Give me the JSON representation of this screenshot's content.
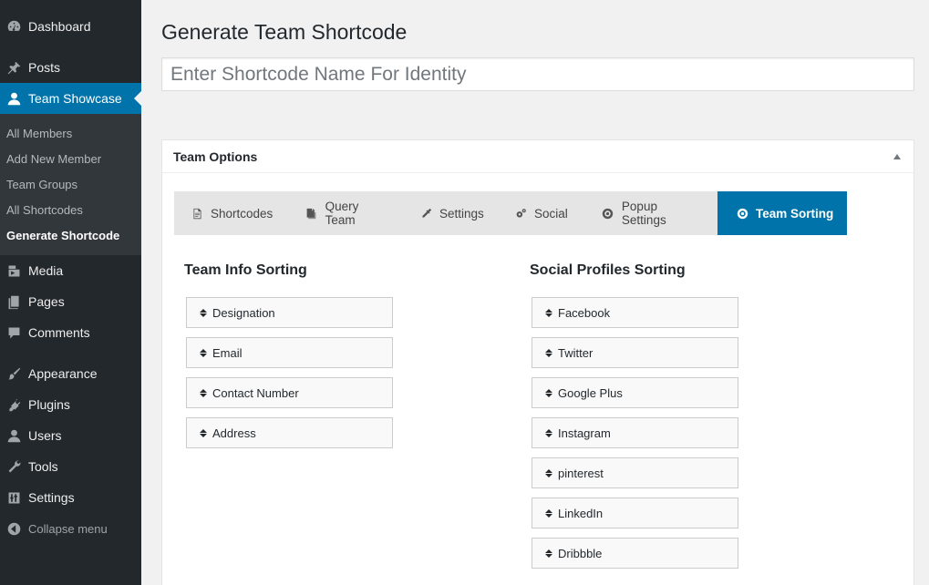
{
  "sidebar": {
    "menu": [
      {
        "label": "Dashboard",
        "icon": "dashboard-icon"
      },
      {
        "label": "Posts",
        "icon": "pin-icon"
      },
      {
        "label": "Team Showcase",
        "icon": "user-icon"
      },
      {
        "label": "Media",
        "icon": "media-icon"
      },
      {
        "label": "Pages",
        "icon": "pages-icon"
      },
      {
        "label": "Comments",
        "icon": "comment-icon"
      },
      {
        "label": "Appearance",
        "icon": "brush-icon"
      },
      {
        "label": "Plugins",
        "icon": "plugin-icon"
      },
      {
        "label": "Users",
        "icon": "users-icon"
      },
      {
        "label": "Tools",
        "icon": "wrench-icon"
      },
      {
        "label": "Settings",
        "icon": "settings-icon"
      }
    ],
    "submenu": [
      "All Members",
      "Add New Member",
      "Team Groups",
      "All Shortcodes",
      "Generate Shortcode"
    ],
    "collapse_label": "Collapse menu"
  },
  "page": {
    "title": "Generate Team Shortcode",
    "name_placeholder": "Enter Shortcode Name For Identity"
  },
  "options": {
    "title": "Team Options",
    "tabs": [
      {
        "label": "Shortcodes",
        "icon": "shortcode-icon"
      },
      {
        "label": "Query Team",
        "icon": "copy-icon"
      },
      {
        "label": "Settings",
        "icon": "eyedropper-icon"
      },
      {
        "label": "Social",
        "icon": "gears-icon"
      },
      {
        "label": "Popup Settings",
        "icon": "lifebuoy-icon"
      },
      {
        "label": "Team Sorting",
        "icon": "lifebuoy-icon"
      }
    ],
    "info_sorting": {
      "title": "Team Info Sorting",
      "items": [
        "Designation",
        "Email",
        "Contact Number",
        "Address"
      ]
    },
    "social_sorting": {
      "title": "Social Profiles Sorting",
      "items": [
        "Facebook",
        "Twitter",
        "Google Plus",
        "Instagram",
        "pinterest",
        "LinkedIn",
        "Dribbble"
      ]
    }
  },
  "colors": {
    "sidebar_bg": "#23282d",
    "submenu_bg": "#32373c",
    "accent": "#0073aa"
  }
}
